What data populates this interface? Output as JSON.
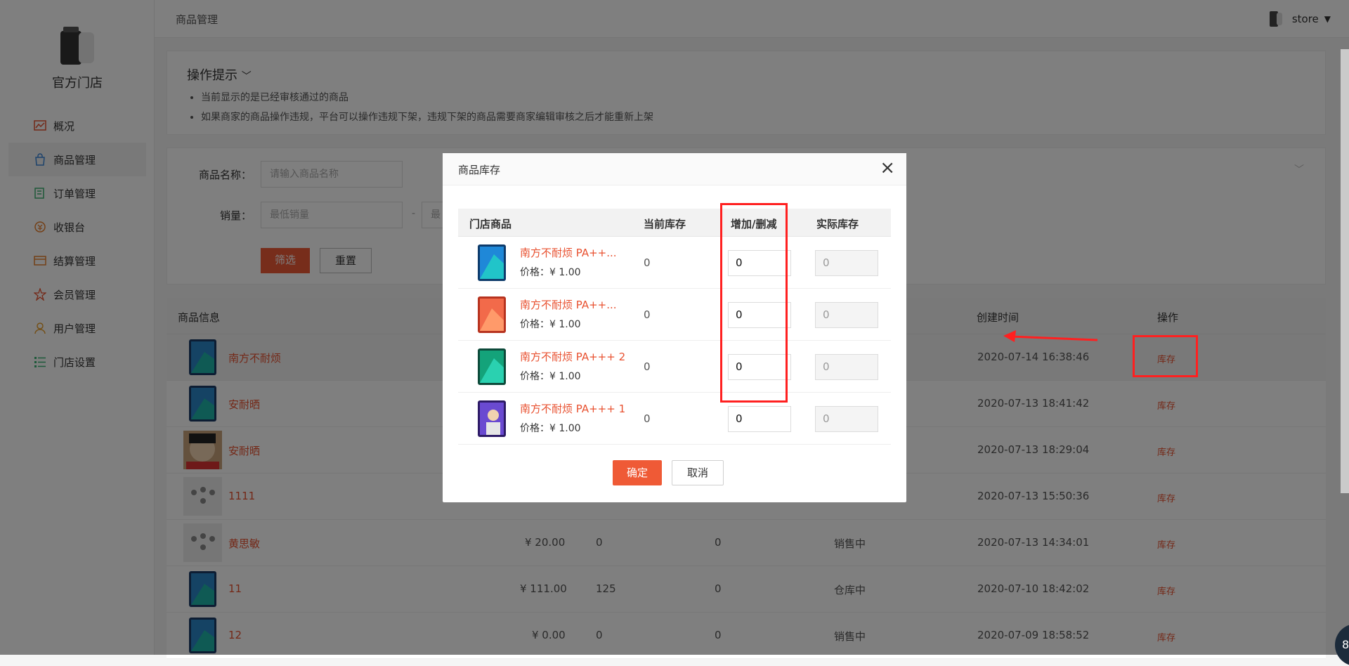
{
  "sidebar": {
    "store_name": "官方门店",
    "items": [
      {
        "label": "概况",
        "icon": "chart-icon"
      },
      {
        "label": "商品管理",
        "icon": "bag-icon"
      },
      {
        "label": "订单管理",
        "icon": "order-icon"
      },
      {
        "label": "收银台",
        "icon": "cashier-icon"
      },
      {
        "label": "结算管理",
        "icon": "settlement-icon"
      },
      {
        "label": "会员管理",
        "icon": "member-icon"
      },
      {
        "label": "用户管理",
        "icon": "user-icon"
      },
      {
        "label": "门店设置",
        "icon": "settings-list-icon"
      }
    ]
  },
  "topbar": {
    "breadcrumb": "商品管理",
    "username": "store"
  },
  "tips": {
    "title": "操作提示",
    "lines": [
      "当前显示的是已经审核通过的商品",
      "如果商家的商品操作违规，平台可以操作违规下架，违规下架的商品需要商家编辑审核之后才能重新上架"
    ]
  },
  "filter": {
    "name_label": "商品名称：",
    "name_placeholder": "请输入商品名称",
    "sales_label": "销量：",
    "sales_min_placeholder": "最低销量",
    "sales_sep": "-",
    "sales_max_placeholder": "最",
    "filter_button": "筛选",
    "reset_button": "重置"
  },
  "table": {
    "headers": {
      "info": "商品信息",
      "created": "创建时间",
      "ops": "操作"
    },
    "rows": [
      {
        "name": "南方不耐烦",
        "price": "",
        "sales": "",
        "stock": "",
        "status": "",
        "created": "2020-07-14 16:38:46",
        "op": "库存"
      },
      {
        "name": "安耐晒",
        "price": "",
        "sales": "",
        "stock": "",
        "status": "",
        "created": "2020-07-13 18:41:42",
        "op": "库存"
      },
      {
        "name": "安耐晒",
        "price": "",
        "sales": "",
        "stock": "",
        "status": "",
        "created": "2020-07-13 18:29:04",
        "op": "库存"
      },
      {
        "name": "1111",
        "price": "",
        "sales": "",
        "stock": "",
        "status": "",
        "created": "2020-07-13 15:50:36",
        "op": "库存"
      },
      {
        "name": "黄思敏",
        "price": "¥ 20.00",
        "sales": "0",
        "stock": "0",
        "status": "销售中",
        "created": "2020-07-13 14:34:01",
        "op": "库存"
      },
      {
        "name": "11",
        "price": "¥ 111.00",
        "sales": "125",
        "stock": "0",
        "status": "仓库中",
        "created": "2020-07-10 18:42:02",
        "op": "库存"
      },
      {
        "name": "12",
        "price": "¥ 0.00",
        "sales": "0",
        "stock": "0",
        "status": "销售中",
        "created": "2020-07-09 18:58:52",
        "op": "库存"
      }
    ]
  },
  "modal": {
    "title": "商品库存",
    "headers": {
      "product": "门店商品",
      "current": "当前库存",
      "adjust": "增加/删减",
      "actual": "实际库存"
    },
    "rows": [
      {
        "name": "南方不耐烦 PA++...",
        "price": "价格：¥ 1.00",
        "current": "0",
        "adjust": "0",
        "actual": "0"
      },
      {
        "name": "南方不耐烦 PA++...",
        "price": "价格：¥ 1.00",
        "current": "0",
        "adjust": "0",
        "actual": "0"
      },
      {
        "name": "南方不耐烦 PA+++ 2",
        "price": "价格：¥ 1.00",
        "current": "0",
        "adjust": "0",
        "actual": "0"
      },
      {
        "name": "南方不耐烦 PA+++ 1",
        "price": "价格：¥ 1.00",
        "current": "0",
        "adjust": "0",
        "actual": "0"
      }
    ],
    "confirm": "确定",
    "cancel": "取消"
  },
  "badge_text": "8",
  "colors": {
    "accent": "#ef5a36",
    "link": "#e8502f",
    "annotation": "#ff2020"
  }
}
